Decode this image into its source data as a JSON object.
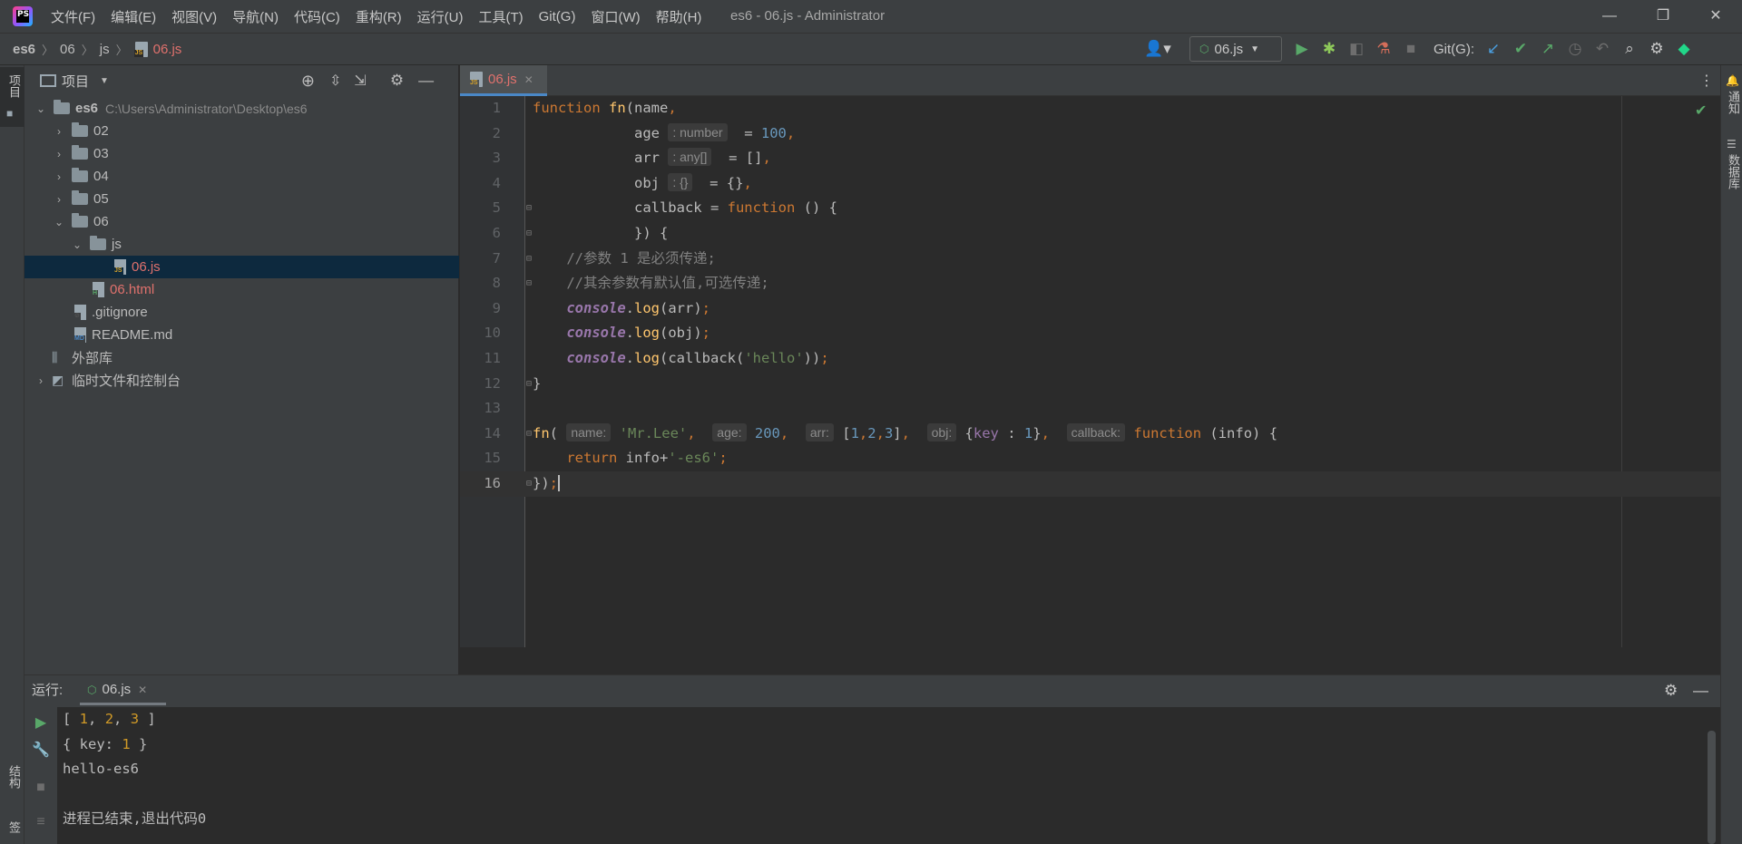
{
  "app": {
    "logo_text": "PS",
    "window_title": "es6 - 06.js - Administrator",
    "menu": [
      "文件(F)",
      "编辑(E)",
      "视图(V)",
      "导航(N)",
      "代码(C)",
      "重构(R)",
      "运行(U)",
      "工具(T)",
      "Git(G)",
      "窗口(W)",
      "帮助(H)"
    ],
    "window_controls": {
      "minimize": "—",
      "restore": "❐",
      "close": "✕"
    }
  },
  "breadcrumb": [
    "es6",
    "06",
    "js",
    "06.js"
  ],
  "toolbar": {
    "run_config": "06.js",
    "git_label": "Git(G):",
    "icons": [
      "user-icon",
      "run-icon",
      "debug-icon",
      "coverage-icon",
      "profile-icon",
      "stop-icon",
      "git-update-icon",
      "git-commit-icon",
      "git-push-icon",
      "history-icon",
      "rollback-icon",
      "search-icon",
      "settings-icon",
      "jetbrains-icon"
    ]
  },
  "left_stripe": {
    "project_tab": "项目",
    "structure_tab": "结构",
    "bookmarks_tab": "书签"
  },
  "right_stripe": {
    "notifications": "通知",
    "database": "数据库"
  },
  "project_panel": {
    "title": "项目",
    "tree": [
      {
        "label": "es6",
        "hint": "C:\\Users\\Administrator\\Desktop\\es6",
        "type": "folder",
        "expanded": true,
        "level": 0
      },
      {
        "label": "02",
        "type": "folder",
        "expanded": false,
        "level": 1
      },
      {
        "label": "03",
        "type": "folder",
        "expanded": false,
        "level": 1
      },
      {
        "label": "04",
        "type": "folder",
        "expanded": false,
        "level": 1
      },
      {
        "label": "05",
        "type": "folder",
        "expanded": false,
        "level": 1
      },
      {
        "label": "06",
        "type": "folder",
        "expanded": true,
        "level": 1
      },
      {
        "label": "js",
        "type": "folder",
        "expanded": true,
        "level": 2
      },
      {
        "label": "06.js",
        "type": "js",
        "level": 3,
        "selected": true
      },
      {
        "label": "06.html",
        "type": "html",
        "level": 2
      },
      {
        "label": ".gitignore",
        "type": "git",
        "level": 1
      },
      {
        "label": "README.md",
        "type": "md",
        "level": 1
      },
      {
        "label": "外部库",
        "type": "lib",
        "level": 0
      },
      {
        "label": "临时文件和控制台",
        "type": "scratch",
        "level": 0
      }
    ]
  },
  "editor": {
    "tab": "06.js",
    "current_line": 16,
    "line_numbers": [
      "1",
      "2",
      "3",
      "4",
      "5",
      "6",
      "7",
      "8",
      "9",
      "10",
      "11",
      "12",
      "13",
      "14",
      "15",
      "16"
    ]
  },
  "run_panel": {
    "label": "运行:",
    "tab": "06.js",
    "output": [
      "[ 1, 2, 3 ]",
      "{ key: 1 }",
      "hello-es6",
      "",
      "进程已结束,退出代码0"
    ]
  }
}
